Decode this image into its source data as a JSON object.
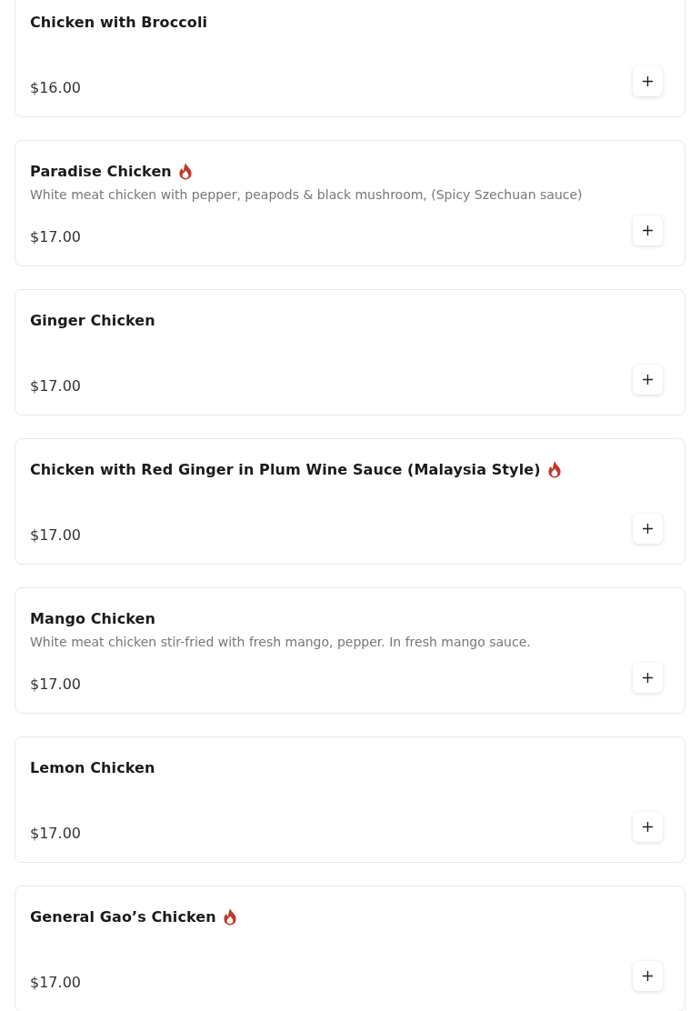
{
  "items": [
    {
      "name": "Chicken with Broccoli",
      "spicy": false,
      "price": "$16.00"
    },
    {
      "name": "Paradise Chicken",
      "spicy": true,
      "description": "White meat chicken with pepper, peapods & black mushroom, (Spicy Szechuan sauce)",
      "price": "$17.00"
    },
    {
      "name": "Ginger Chicken",
      "spicy": false,
      "price": "$17.00"
    },
    {
      "name": "Chicken with Red Ginger in Plum Wine Sauce (Malaysia Style)",
      "spicy": true,
      "price": "$17.00"
    },
    {
      "name": "Mango Chicken",
      "spicy": false,
      "description": "White meat chicken stir-fried with fresh mango, pepper. In fresh mango sauce.",
      "price": "$17.00"
    },
    {
      "name": "Lemon Chicken",
      "spicy": false,
      "price": "$17.00"
    },
    {
      "name": "General Gao’s Chicken",
      "spicy": true,
      "price": "$17.00"
    }
  ]
}
